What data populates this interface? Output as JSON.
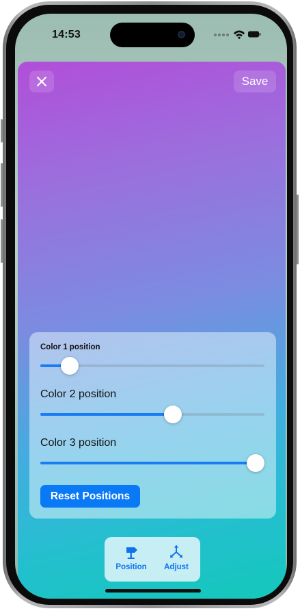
{
  "status_bar": {
    "time": "14:53",
    "icons": [
      "camera-indicator-icon",
      "signal-dots-icon",
      "wifi-icon",
      "battery-icon"
    ]
  },
  "editor": {
    "close_icon": "close-icon",
    "save_label": "Save",
    "gradient_colors": [
      "#b14ed9",
      "#7b8ce0",
      "#41aedf",
      "#14c8bb"
    ]
  },
  "panel": {
    "sliders": [
      {
        "label": "Color 1 position",
        "value": 0.13
      },
      {
        "label": "Color 2 position",
        "value": 0.59
      },
      {
        "label": "Color 3 position",
        "value": 0.96
      }
    ],
    "reset_label": "Reset Positions"
  },
  "tabs": [
    {
      "label": "Position",
      "icon": "signpost-icon"
    },
    {
      "label": "Adjust",
      "icon": "adjust-arrows-icon"
    }
  ],
  "colors": {
    "accent": "#0a79f6",
    "slider_fill": "#1a7cf2"
  }
}
